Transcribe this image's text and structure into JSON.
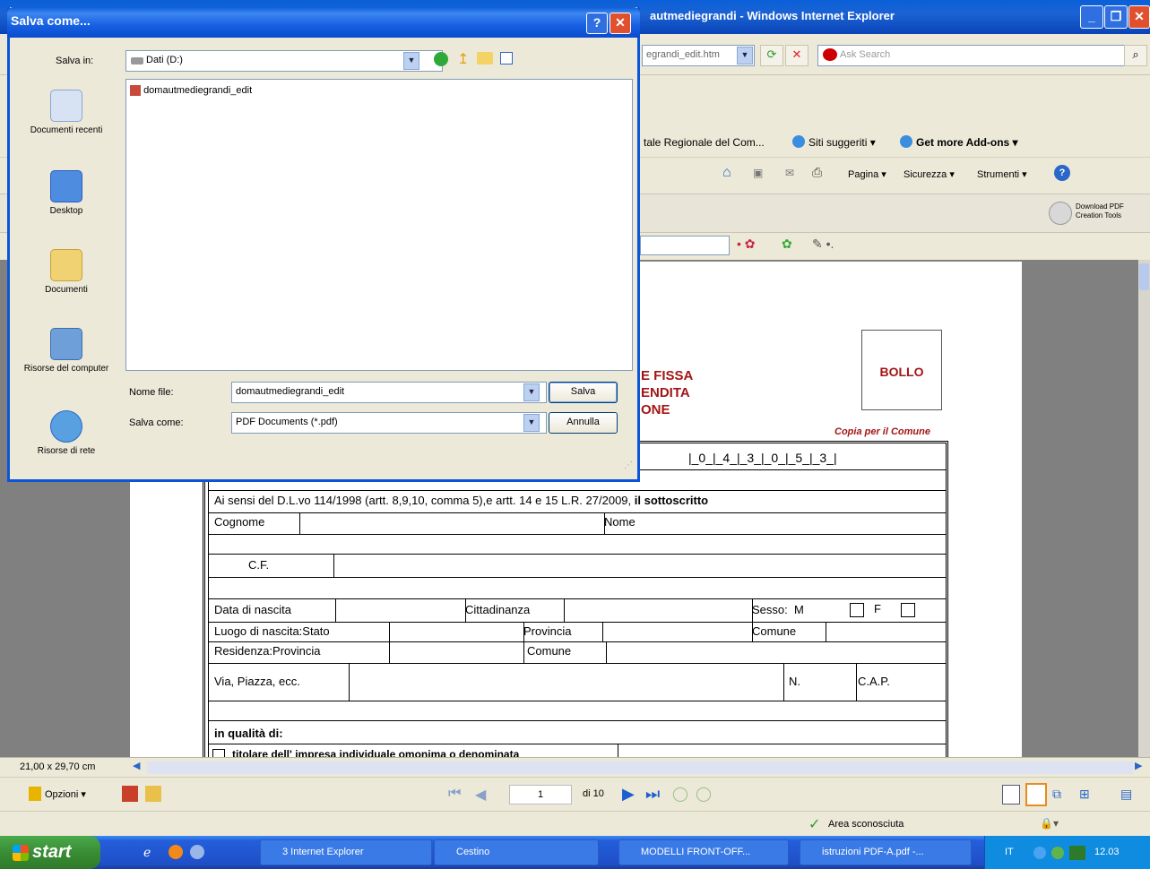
{
  "ie": {
    "title": "autmediegrandi - Windows Internet Explorer",
    "address": "egrandi_edit.htm",
    "search_placeholder": "Ask Search",
    "favorites": [
      "tale Regionale del Com...",
      "Siti suggeriti ▾",
      "Get more Add-ons ▾"
    ],
    "command_bar": [
      "Pagina ▾",
      "Sicurezza ▾",
      "Strumenti ▾"
    ],
    "pdf_download": "Download PDF Creation Tools"
  },
  "document": {
    "heading_lines": [
      "E FISSA",
      "ENDITA",
      "ONE"
    ],
    "bollo": "BOLLO",
    "copia": "Copia per il Comune",
    "code": "|_0_|_4_|_3_|_0_|_5_|_3_|",
    "intro": "Ai sensi del D.L.vo 114/1998 (artt. 8,9,10, comma 5),e artt. 14 e 15 L.R. 27/2009,",
    "intro_bold": "il sottoscritto",
    "cognome": "Cognome",
    "nome": "Nome",
    "cf": "C.F.",
    "data_nascita": "Data di nascita",
    "cittadinanza": "Cittadinanza",
    "sesso": "Sesso:",
    "m": "M",
    "f": "F",
    "luogo": "Luogo di nascita:Stato",
    "provincia": "Provincia",
    "comune": "Comune",
    "residenza": "Residenza:Provincia",
    "comune2": "Comune",
    "via": "Via, Piazza, ecc.",
    "n": "N.",
    "cap": "C.A.P.",
    "qualita": "in qualità di:",
    "titolare": "titolare dell' impresa individuale omonima o denominata"
  },
  "pdf_status": {
    "page_size": "21,00 x 29,70 cm",
    "options": "Opzioni ▾",
    "page_current": "1",
    "page_total": "di 10"
  },
  "ie_status": {
    "zone": "Area sconosciuta"
  },
  "dialog": {
    "title": "Salva come...",
    "save_in_label": "Salva in:",
    "save_in_value": "Dati (D:)",
    "places": [
      "Documenti recenti",
      "Desktop",
      "Documenti",
      "Risorse del computer",
      "Risorse di rete"
    ],
    "files": [
      "domautmediegrandi_edit"
    ],
    "filename_label": "Nome file:",
    "filename_value": "domautmediegrandi_edit",
    "type_label": "Salva come:",
    "type_value": "PDF Documents (*.pdf)",
    "save_button": "Salva",
    "cancel_button": "Annulla"
  },
  "taskbar": {
    "start": "start",
    "tasks": [
      "3 Internet Explorer",
      "Cestino",
      "MODELLI FRONT-OFF...",
      "istruzioni PDF-A.pdf -..."
    ],
    "lang": "IT",
    "clock": "12.03"
  },
  "colors": {
    "title_blue": "#0a55d8",
    "form_red": "#a31515",
    "taskbar_blue": "#245edb",
    "start_green": "#3a8d34"
  }
}
